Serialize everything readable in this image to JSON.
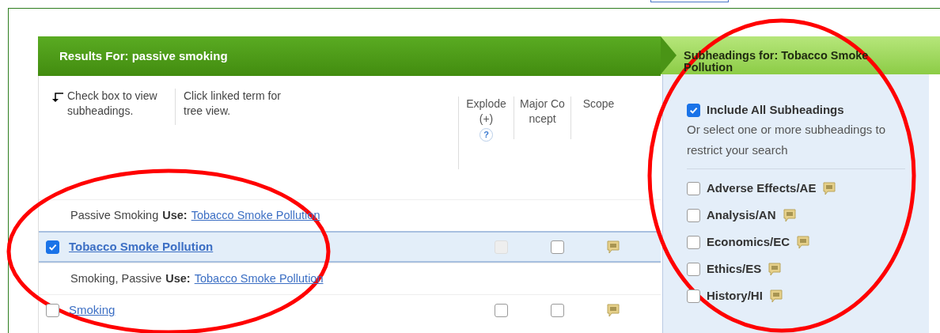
{
  "results": {
    "title": "Results For: passive smoking",
    "instructions": [
      "Check box to view subheadings.",
      "Click linked term for tree view."
    ],
    "columns": [
      "Explode (+)",
      "Major Concept",
      "Scope"
    ],
    "help": "?",
    "rows": [
      {
        "kind": "see",
        "term": "Passive Smoking",
        "use_label": "Use:",
        "target": "Tobacco Smoke Pollution"
      },
      {
        "kind": "term",
        "label": "Tobacco Smoke Pollution",
        "checked": true,
        "selected": true,
        "explode_disabled": true,
        "major_checked": false
      },
      {
        "kind": "see",
        "term": "Smoking, Passive",
        "use_label": "Use:",
        "target": "Tobacco Smoke Pollution"
      },
      {
        "kind": "term",
        "label": "Smoking",
        "checked": false,
        "selected": false,
        "explode_disabled": false,
        "major_checked": false
      }
    ]
  },
  "subheadings": {
    "title": "Subheadings for: Tobacco Smoke Pollution",
    "include_all": {
      "label": "Include All Subheadings",
      "checked": true
    },
    "hint": "Or select one or more subheadings to restrict your search",
    "items": [
      {
        "label": "Adverse Effects/AE",
        "checked": false
      },
      {
        "label": "Analysis/AN",
        "checked": false
      },
      {
        "label": "Economics/EC",
        "checked": false
      },
      {
        "label": "Ethics/ES",
        "checked": false
      },
      {
        "label": "History/HI",
        "checked": false
      }
    ]
  }
}
